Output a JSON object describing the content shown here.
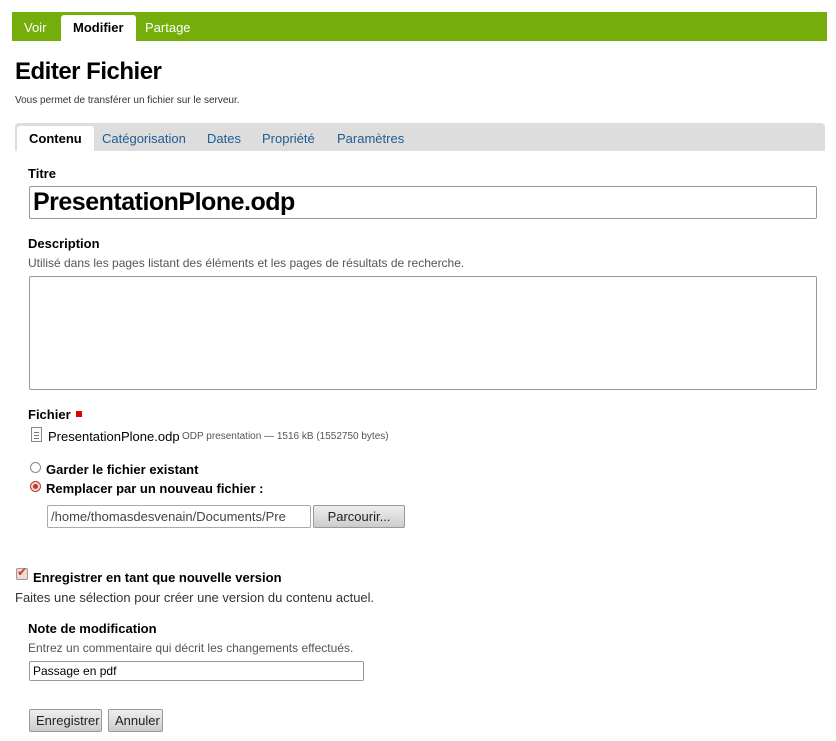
{
  "top_tabs": [
    {
      "label": "Voir",
      "active": false
    },
    {
      "label": "Modifier",
      "active": true
    },
    {
      "label": "Partage",
      "active": false
    }
  ],
  "page": {
    "title": "Editer Fichier",
    "subtitle": "Vous permet de transférer un fichier sur le serveur."
  },
  "form_tabs": [
    {
      "label": "Contenu",
      "active": true
    },
    {
      "label": "Catégorisation",
      "active": false
    },
    {
      "label": "Dates",
      "active": false
    },
    {
      "label": "Propriété",
      "active": false
    },
    {
      "label": "Paramètres",
      "active": false
    }
  ],
  "titre": {
    "label": "Titre",
    "value": "PresentationPlone.odp"
  },
  "description": {
    "label": "Description",
    "help": "Utilisé dans les pages listant des éléments et les pages de résultats de recherche.",
    "value": ""
  },
  "fichier": {
    "label": "Fichier",
    "required": true,
    "icon": "document-icon",
    "file_name": "PresentationPlone.odp",
    "file_meta": "ODP presentation — 1516 kB (1552750 bytes)",
    "option_keep": "Garder le fichier existant",
    "option_replace": "Remplacer par un nouveau fichier :",
    "selected": "replace",
    "path_value": "/home/thomasdesvenain/Documents/Pre",
    "browse_label": "Parcourir..."
  },
  "versioning": {
    "label": "Enregistrer en tant que nouvelle version",
    "checked": true,
    "help": "Faites une sélection pour créer une version du contenu actuel."
  },
  "note": {
    "label": "Note de modification",
    "help": "Entrez un commentaire qui décrit les changements effectués.",
    "value": "Passage en pdf"
  },
  "actions": {
    "save": "Enregistrer",
    "cancel": "Annuler"
  },
  "colors": {
    "nav_green": "#75ad0a",
    "link_blue": "#205c90",
    "required_red": "#e00000"
  }
}
